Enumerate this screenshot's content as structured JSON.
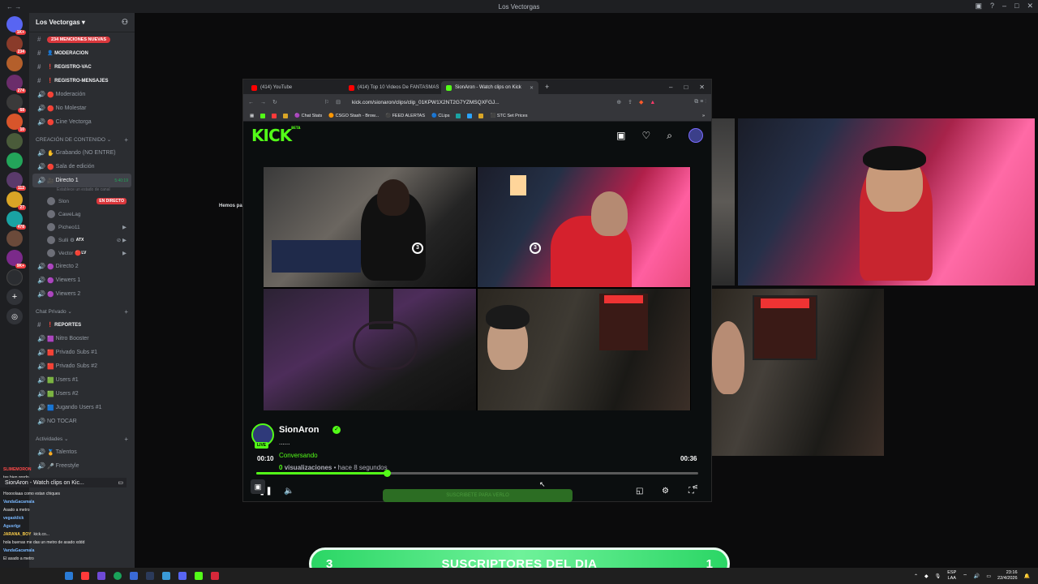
{
  "window": {
    "title": "Los Vectorgas"
  },
  "server": {
    "name": "Los Vectorgas",
    "unread_pill": "234 MENCIONES NUEVAS",
    "text_channels": [
      {
        "name": "MODERACION"
      },
      {
        "name": "REGISTRO-VAC"
      },
      {
        "name": "REGISTRO-MENSAJES"
      }
    ],
    "voice_channels_top": [
      "Moderación",
      "No Molestar",
      "Cine Vectorga"
    ],
    "category_content": "CREACIÓN DE CONTENIDO",
    "content_channels": [
      "Grabando (NO ENTRE)",
      "Sala de edición"
    ],
    "active_voice": {
      "name": "Directo 1",
      "timer": "5:40:19",
      "status": "Establece un estado de canal"
    },
    "voice_users": [
      {
        "name": "Slon",
        "tag": "EN DIRECTO"
      },
      {
        "name": "CaweLag",
        "tag": ""
      },
      {
        "name": "Picheo11",
        "tag": ""
      },
      {
        "name": "Sulli",
        "tag": "ATX"
      },
      {
        "name": "Vector",
        "tag": "LV"
      }
    ],
    "more_voice": [
      "Directo 2",
      "Viewers 1",
      "Viewers 2"
    ],
    "category_private": "Chat Privado",
    "private_channels": [
      "REPORTES",
      "Nitro Booster",
      "Privado Subs #1",
      "Privado Subs #2",
      "Users #1",
      "Users #2",
      "Jugando Users #1",
      "NO TOCAR"
    ],
    "category_activities": "Actividades",
    "activity_channels": [
      "Talentos",
      "Freestyle"
    ]
  },
  "now_playing": "SionAron - Watch clips on Kic...",
  "chat": [
    {
      "name": "SLIMEMORON",
      "text": ""
    },
    {
      "name": "",
      "text": "tas bien gordo"
    },
    {
      "name": "SakhaMeMeTK",
      "text": ""
    },
    {
      "name": "",
      "text": "Hoooolaaa como estan chiques"
    },
    {
      "name": "VandaGacamala",
      "text": ""
    },
    {
      "name": "",
      "text": "Asado a metro"
    },
    {
      "name": "vegasklick",
      "text": ""
    },
    {
      "name": "Agusrlgz",
      "text": ""
    },
    {
      "name": "JARANA_BOY",
      "text": "kick.co..."
    },
    {
      "name": "",
      "text": "hola buenas me das un metro de asado xddd"
    },
    {
      "name": "VandaGacamala",
      "text": ""
    },
    {
      "name": "",
      "text": "El asado a metro"
    }
  ],
  "browser": {
    "tabs": [
      {
        "label": "(414) YouTube",
        "active": false
      },
      {
        "label": "(414) Top 10 Videos De FANTASMAS",
        "active": false
      },
      {
        "label": "SionAron - Watch clips on Kick",
        "active": true
      }
    ],
    "url": "kick.com/sionaron/clips/clip_01KPW1X2NT2G7YZMSQXFGJ...",
    "bookmarks": [
      "Chat Stats",
      "CSGO Stash - Brow...",
      "FEED ALERTAS",
      "CLips",
      "STC Set Prices"
    ]
  },
  "kick": {
    "logo": "KICK",
    "beta": "BETA",
    "player": {
      "current_time": "00:10",
      "duration": "00:36",
      "progress": 0.296,
      "rewind_label": "3",
      "ghost_button": "SUSCRIBETE PARA VERLO"
    },
    "streamer": {
      "name": "SionAron",
      "live_badge": "LIVE",
      "title": "......",
      "category": "Conversando",
      "views_count": "0",
      "views_label": "visualizaciones",
      "time_ago": "• hace 8 segundos"
    }
  },
  "background_text": "Hemos pa",
  "subs_bar": {
    "left_number": "3",
    "label": "SUSCRIPTORES DEL DIA",
    "right_number": "1"
  },
  "tray": {
    "lang_top": "ESP",
    "lang_bottom": "LAA",
    "time": "23:16",
    "date": "22/4/2026"
  },
  "colors": {
    "kick_green": "#53fc18",
    "discord_bg": "#2b2d31",
    "subs_bar": "#2bd665"
  }
}
